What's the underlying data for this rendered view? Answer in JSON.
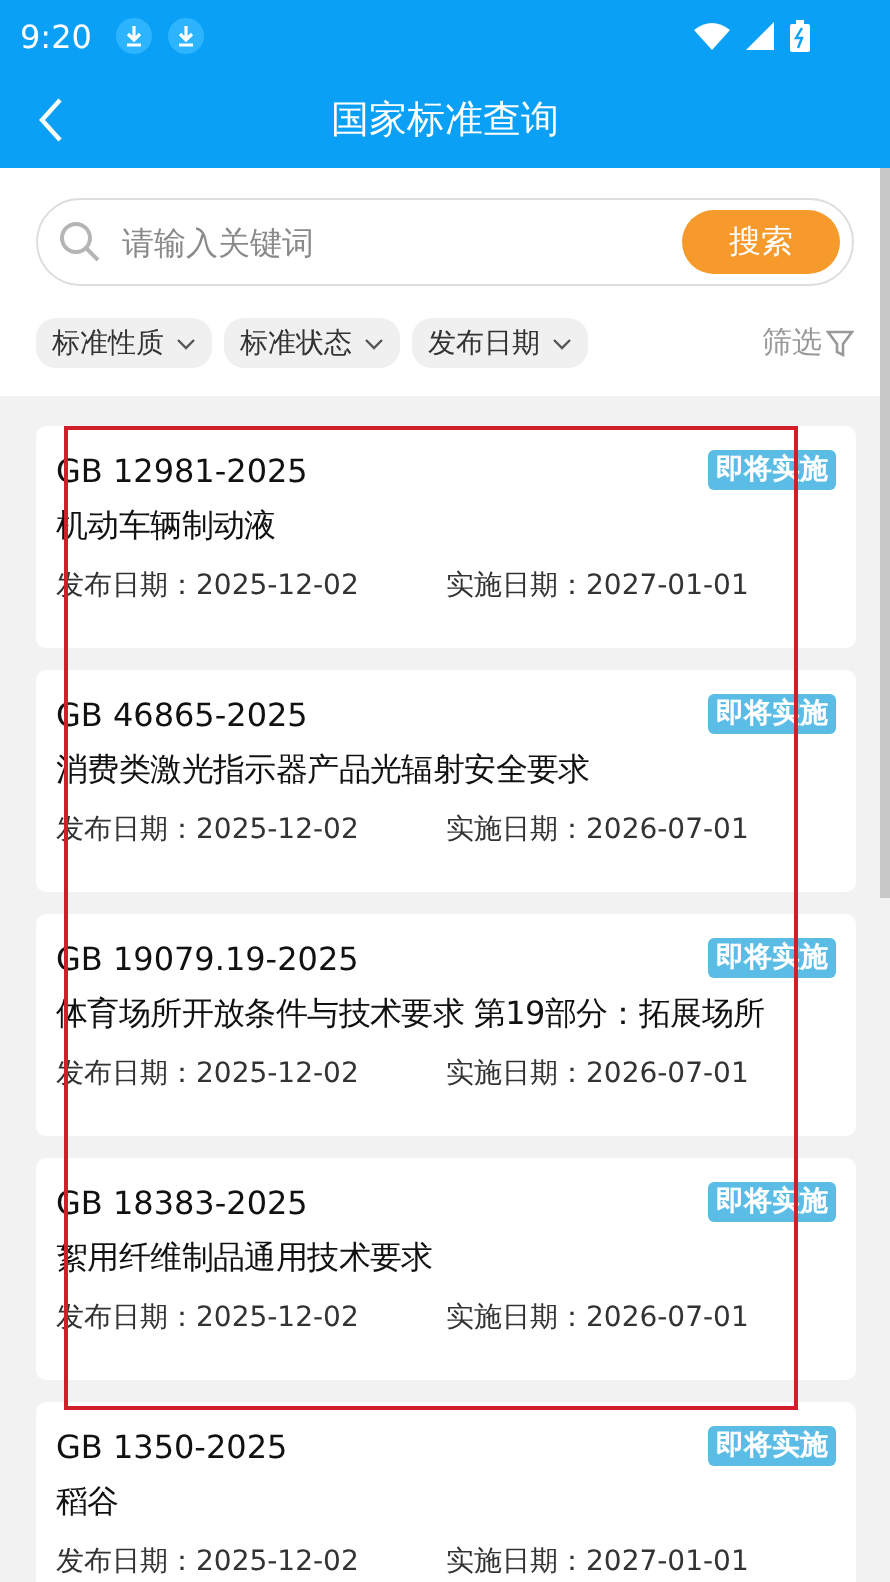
{
  "status_bar": {
    "time": "9:20"
  },
  "header": {
    "title": "国家标准查询"
  },
  "search": {
    "placeholder": "请输入关键词",
    "button": "搜索"
  },
  "filters": [
    {
      "label": "标准性质"
    },
    {
      "label": "标准状态"
    },
    {
      "label": "发布日期"
    }
  ],
  "filter_button": "筛选",
  "results": [
    {
      "code": "GB 12981-2025",
      "status": "即将实施",
      "name": "机动车辆制动液",
      "publish_label": "发布日期：",
      "publish_date": "2025-12-02",
      "effective_label": "实施日期：",
      "effective_date": "2027-01-01"
    },
    {
      "code": "GB 46865-2025",
      "status": "即将实施",
      "name": "消费类激光指示器产品光辐射安全要求",
      "publish_label": "发布日期：",
      "publish_date": "2025-12-02",
      "effective_label": "实施日期：",
      "effective_date": "2026-07-01"
    },
    {
      "code": "GB 19079.19-2025",
      "status": "即将实施",
      "name": "体育场所开放条件与技术要求 第19部分：拓展场所",
      "publish_label": "发布日期：",
      "publish_date": "2025-12-02",
      "effective_label": "实施日期：",
      "effective_date": "2026-07-01"
    },
    {
      "code": "GB 18383-2025",
      "status": "即将实施",
      "name": "絮用纤维制品通用技术要求",
      "publish_label": "发布日期：",
      "publish_date": "2025-12-02",
      "effective_label": "实施日期：",
      "effective_date": "2026-07-01"
    },
    {
      "code": "GB 1350-2025",
      "status": "即将实施",
      "name": "稻谷",
      "publish_label": "发布日期：",
      "publish_date": "2025-12-02",
      "effective_label": "实施日期：",
      "effective_date": "2027-01-01"
    }
  ],
  "annotation": {
    "kind": "frame"
  }
}
